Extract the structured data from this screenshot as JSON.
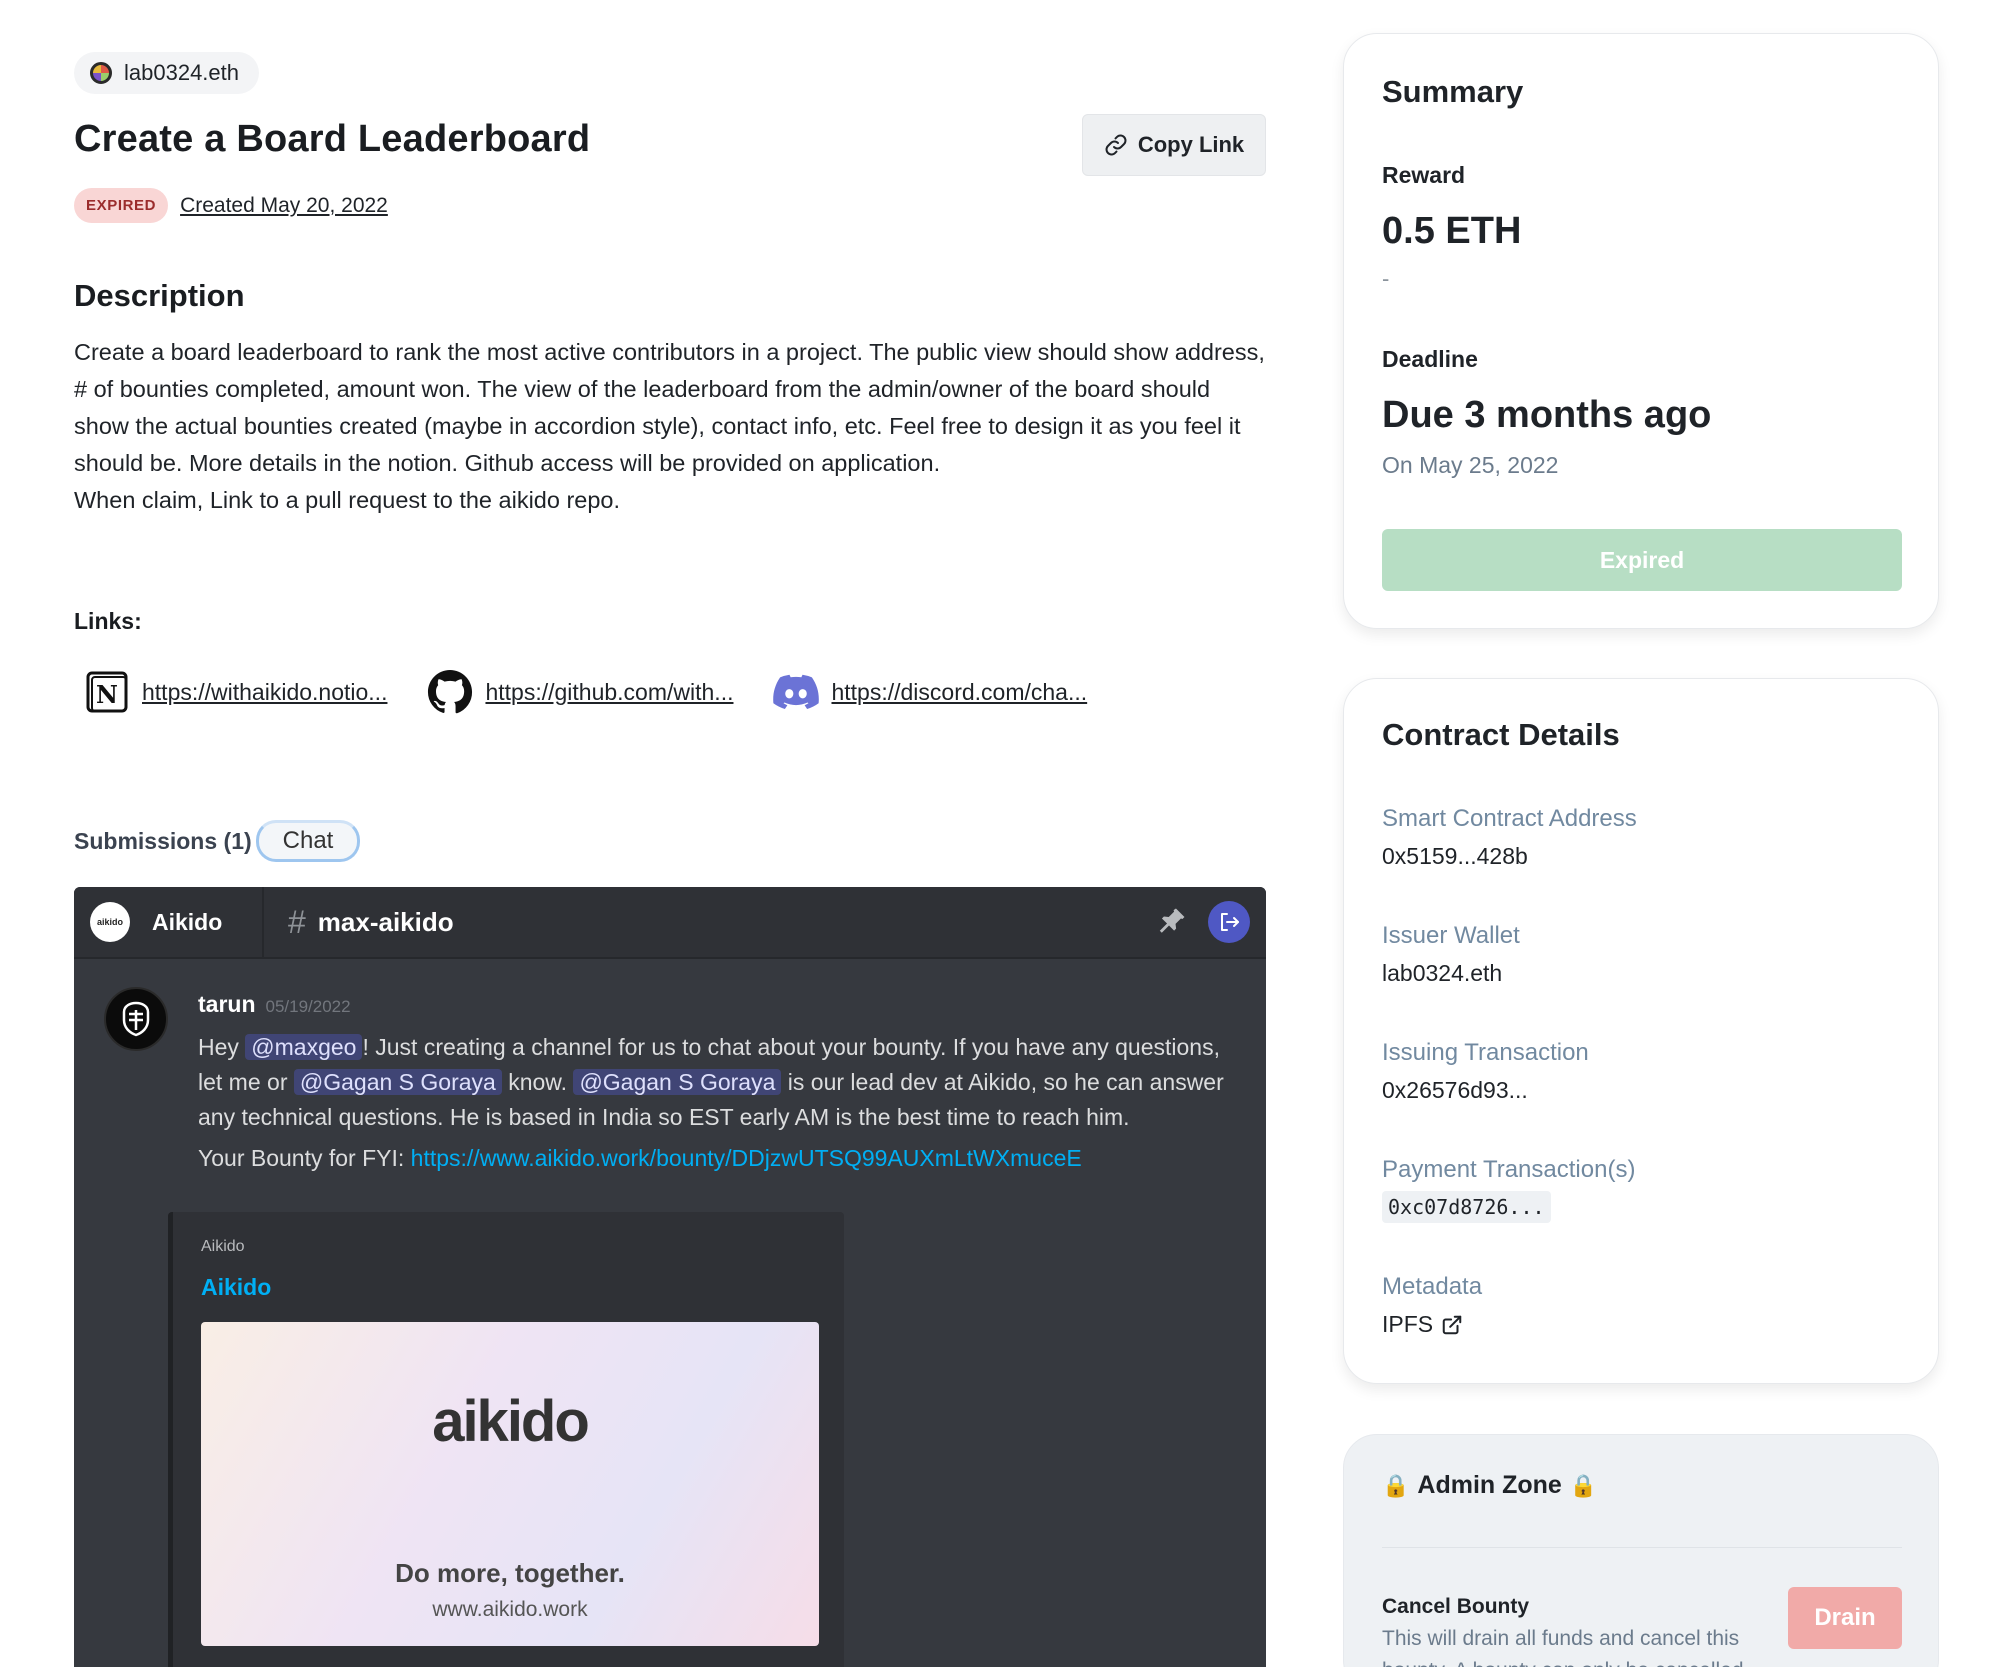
{
  "header": {
    "issuer": "lab0324.eth",
    "title": "Create a Board Leaderboard",
    "copy_link_label": "Copy Link",
    "status_badge": "EXPIRED",
    "created_text": "Created May 20, 2022"
  },
  "description": {
    "heading": "Description",
    "paragraph1": "Create a board leaderboard to rank the most active contributors in a project. The public view should show address, # of bounties completed, amount won. The view of the leaderboard from the admin/owner of the board should show the actual bounties created (maybe in accordion style), contact info, etc. Feel free to design it as you feel it should be. More details in the notion. Github access will be provided on application.",
    "paragraph2": "When claim, Link to a pull request to the aikido repo."
  },
  "links": {
    "heading": "Links:",
    "items": [
      {
        "icon": "notion-icon",
        "text": "https://withaikido.notio..."
      },
      {
        "icon": "github-icon",
        "text": "https://github.com/with..."
      },
      {
        "icon": "discord-icon",
        "text": "https://discord.com/cha..."
      }
    ]
  },
  "submissions": {
    "label": "Submissions (1)",
    "chat_label": "Chat"
  },
  "discord": {
    "server_icon_text": "aikido",
    "server_name": "Aikido",
    "channel_hash": "#",
    "channel_name": "max-aikido",
    "message": {
      "author": "tarun",
      "timestamp": "05/19/2022",
      "t1": "Hey ",
      "m1": "@maxgeo",
      "t2": "! Just creating a channel for us to chat about your bounty. If you have any questions, let me or ",
      "m2": "@Gagan S Goraya",
      "t3": " know. ",
      "m3": "@Gagan S Goraya",
      "t4": " is our lead dev at Aikido, so he can answer any technical questions. He is based in India so EST early AM is the best time to reach him.",
      "bounty_prefix": "Your Bounty for FYI: ",
      "bounty_link": "https://www.aikido.work/bounty/DDjzwUTSQ99AUXmLtWXmuceE"
    },
    "embed": {
      "provider": "Aikido",
      "title": "Aikido",
      "logo_text": "aikido",
      "tagline": "Do more, together.",
      "url": "www.aikido.work"
    }
  },
  "summary": {
    "title": "Summary",
    "reward_label": "Reward",
    "reward_value": "0.5 ETH",
    "reward_sub": "-",
    "deadline_label": "Deadline",
    "deadline_value": "Due 3 months ago",
    "deadline_date": "On May 25, 2022",
    "expired_button": "Expired"
  },
  "contract": {
    "title": "Contract Details",
    "fields": [
      {
        "label": "Smart Contract Address",
        "value": "0x5159...428b"
      },
      {
        "label": "Issuer Wallet",
        "value": "lab0324.eth"
      },
      {
        "label": "Issuing Transaction",
        "value": "0x26576d93..."
      },
      {
        "label": "Payment Transaction(s)",
        "value": "0xc07d8726..."
      },
      {
        "label": "Metadata",
        "value": "IPFS"
      }
    ]
  },
  "admin": {
    "title": "Admin Zone",
    "lock_glyph": "🔒",
    "cancel_title": "Cancel Bounty",
    "cancel_desc": "This will drain all funds and cancel this bounty. A bounty can only be cancelled",
    "drain_label": "Drain"
  },
  "colors": {
    "expired_badge_bg": "#f9d6d5",
    "expired_button_bg": "#b7dec4",
    "drain_button_bg": "#f1aaa8",
    "discord_bg": "#36393f",
    "discord_link": "#00aff4",
    "mention_bg": "#5865f2"
  }
}
